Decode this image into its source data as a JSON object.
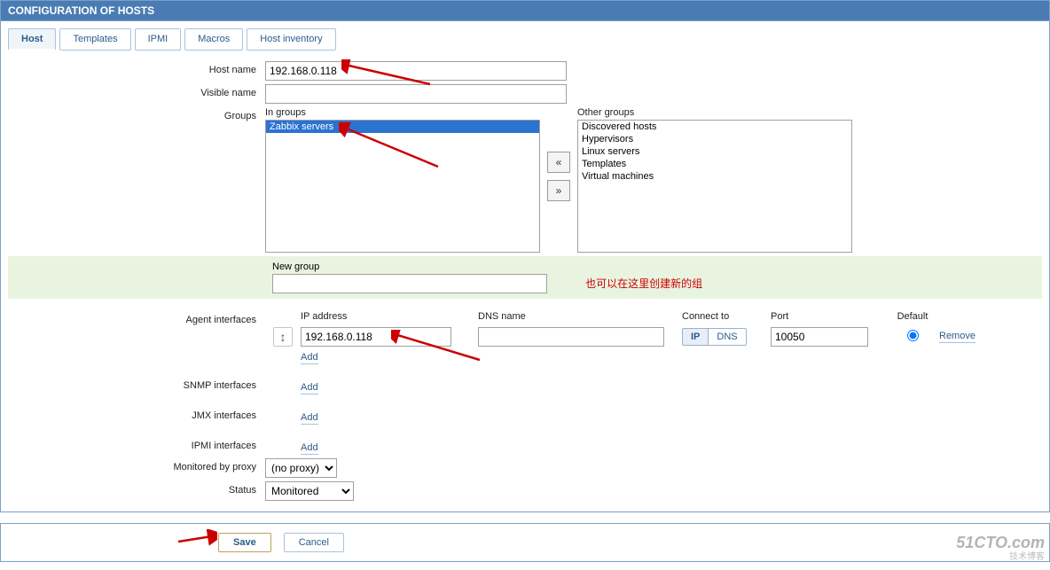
{
  "header": {
    "title": "CONFIGURATION OF HOSTS"
  },
  "tabs": {
    "host": "Host",
    "templates": "Templates",
    "ipmi": "IPMI",
    "macros": "Macros",
    "inventory": "Host inventory"
  },
  "labels": {
    "host_name": "Host name",
    "visible_name": "Visible name",
    "groups": "Groups",
    "in_groups": "In groups",
    "other_groups": "Other groups",
    "new_group": "New group",
    "new_group_note": "也可以在这里创建新的组",
    "agent_interfaces": "Agent interfaces",
    "snmp_interfaces": "SNMP interfaces",
    "jmx_interfaces": "JMX interfaces",
    "ipmi_interfaces": "IPMI interfaces",
    "monitored_by_proxy": "Monitored by proxy",
    "status": "Status",
    "ip_address": "IP address",
    "dns_name": "DNS name",
    "connect_to": "Connect to",
    "port": "Port",
    "default": "Default",
    "remove": "Remove",
    "add": "Add",
    "ip": "IP",
    "dns": "DNS",
    "left": "«",
    "right": "»"
  },
  "values": {
    "host_name": "192.168.0.118",
    "visible_name": "",
    "new_group": "",
    "agent_ip": "192.168.0.118",
    "agent_dns": "",
    "agent_port": "10050",
    "proxy": "(no proxy)",
    "status": "Monitored"
  },
  "in_groups": [
    "Zabbix servers"
  ],
  "other_groups": [
    "Discovered hosts",
    "Hypervisors",
    "Linux servers",
    "Templates",
    "Virtual machines"
  ],
  "buttons": {
    "save": "Save",
    "cancel": "Cancel"
  },
  "watermark": {
    "brand": "51CTO.com",
    "sub": "技术博客"
  }
}
